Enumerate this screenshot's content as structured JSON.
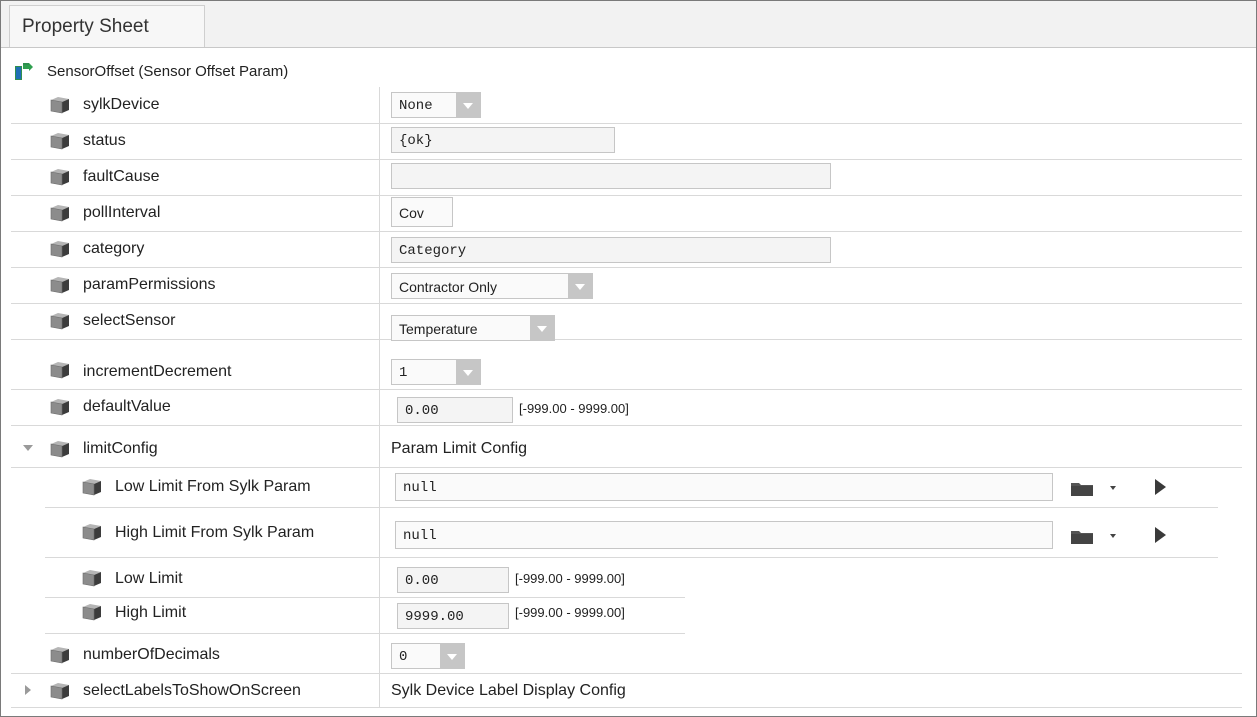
{
  "tab": {
    "label": "Property Sheet"
  },
  "root": {
    "label": "SensorOffset  (Sensor Offset Param)"
  },
  "properties": {
    "sylkDevice": {
      "name": "sylkDevice",
      "value": "None"
    },
    "status": {
      "name": "status",
      "value": "{ok}"
    },
    "faultCause": {
      "name": "faultCause",
      "value": ""
    },
    "pollInterval": {
      "name": "pollInterval",
      "value": "Cov"
    },
    "category": {
      "name": "category",
      "value": "Category"
    },
    "paramPermissions": {
      "name": "paramPermissions",
      "value": "Contractor Only"
    },
    "selectSensor": {
      "name": "selectSensor",
      "value": "Temperature"
    },
    "incrementDecrement": {
      "name": "incrementDecrement",
      "value": "1"
    },
    "defaultValue": {
      "name": "defaultValue",
      "value": "0.00",
      "range": "[-999.00 - 9999.00]"
    },
    "limitConfig": {
      "name": "limitConfig",
      "value": "Param Limit Config",
      "children": {
        "lowLimitFromSylkParam": {
          "name": "Low Limit From Sylk Param",
          "value": "null"
        },
        "highLimitFromSylkParam": {
          "name": "High Limit From Sylk Param",
          "value": "null"
        },
        "lowLimit": {
          "name": "Low Limit",
          "value": "0.00",
          "range": "[-999.00 - 9999.00]"
        },
        "highLimit": {
          "name": "High Limit",
          "value": "9999.00",
          "range": "[-999.00 - 9999.00]"
        }
      }
    },
    "numberOfDecimals": {
      "name": "numberOfDecimals",
      "value": "0"
    },
    "selectLabelsToShowOnScreen": {
      "name": "selectLabelsToShowOnScreen",
      "value": "Sylk Device Label Display Config"
    }
  },
  "icons": {
    "root": "component-link-icon",
    "slot": "slot-cube-icon",
    "folder": "folder-icon",
    "menu": "menu-caret-icon",
    "action": "play-icon"
  },
  "colors": {
    "dropdown_button": "#c6c6c6",
    "field_bg": "#f4f4f4",
    "grid_line": "#d9d9d9"
  }
}
